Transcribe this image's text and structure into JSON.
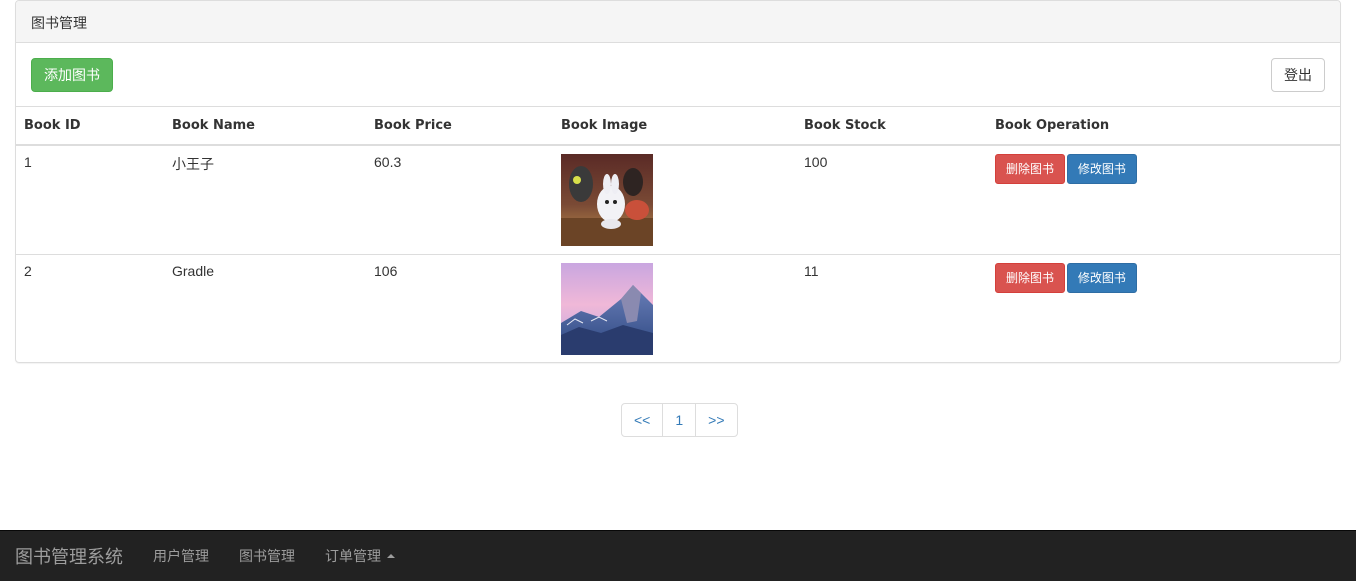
{
  "panel": {
    "title": "图书管理",
    "add_label": "添加图书",
    "logout_label": "登出"
  },
  "table": {
    "headers": [
      "Book ID",
      "Book Name",
      "Book Price",
      "Book Image",
      "Book Stock",
      "Book Operation"
    ],
    "rows": [
      {
        "id": "1",
        "name": "小王子",
        "price": "60.3",
        "image": "cartoon-bunny",
        "stock": "100",
        "delete_label": "删除图书",
        "edit_label": "修改图书"
      },
      {
        "id": "2",
        "name": "Gradle",
        "price": "106",
        "image": "mountain-landscape",
        "stock": "11",
        "delete_label": "删除图书",
        "edit_label": "修改图书"
      }
    ]
  },
  "pagination": {
    "prev": "<<",
    "current": "1",
    "next": ">>"
  },
  "navbar": {
    "brand": "图书管理系统",
    "items": [
      "用户管理",
      "图书管理",
      "订单管理"
    ],
    "dropdown_icon": "caret-up-icon"
  },
  "colors": {
    "success": "#5cb85c",
    "danger": "#d9534f",
    "primary": "#337ab7",
    "navbar": "#222222"
  }
}
